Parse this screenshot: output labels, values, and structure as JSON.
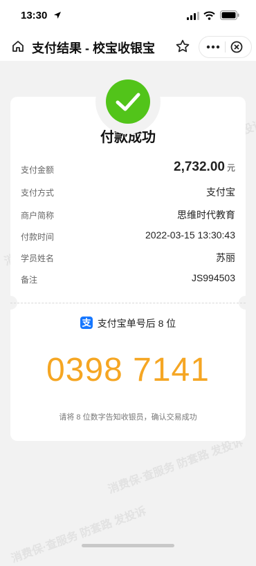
{
  "status_bar": {
    "time": "13:30"
  },
  "nav": {
    "title": "支付结果 - 校宝收银宝"
  },
  "result": {
    "title": "付款成功"
  },
  "details": [
    {
      "label": "支付金额",
      "value": "2,732.00",
      "unit": "元"
    },
    {
      "label": "支付方式",
      "value": "支付宝"
    },
    {
      "label": "商户简称",
      "value": "思维时代教育"
    },
    {
      "label": "付款时间",
      "value": "2022-03-15 13:30:43"
    },
    {
      "label": "学员姓名",
      "value": "苏丽"
    },
    {
      "label": "备注",
      "value": "JS994503"
    }
  ],
  "alipay": {
    "label": "支付宝单号后 8 位",
    "code": "0398 7141",
    "hint": "请将 8 位数字告知收银员，确认交易成功"
  },
  "watermark": {
    "text": "消费保·查服务 防套路 发投诉"
  },
  "colors": {
    "success": "#52c41a",
    "code": "#f5a623",
    "alipay": "#1677ff"
  }
}
